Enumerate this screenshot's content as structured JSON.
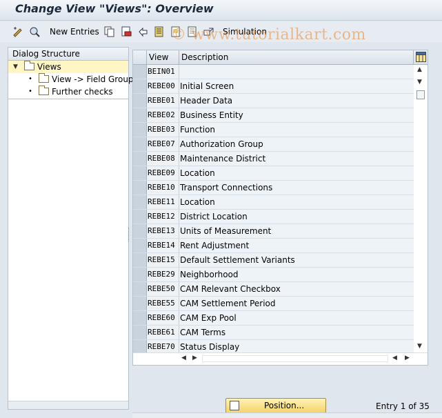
{
  "window": {
    "title": "Change View \"Views\": Overview"
  },
  "toolbar": {
    "new_entries_label": "New Entries",
    "simulation_label": "Simulation",
    "icons": [
      "display-change-icon",
      "display-icon",
      "copy-icon",
      "delete-icon",
      "undo-icon",
      "select-all-icon",
      "select-block-icon",
      "deselect-icon",
      "transport-icon"
    ]
  },
  "watermark": "© www.tutorialkart.com",
  "dialog_structure": {
    "header": "Dialog Structure",
    "items": [
      {
        "label": "Views",
        "selected": true
      },
      {
        "label": "View -> Field Groups"
      },
      {
        "label": "Further checks"
      }
    ]
  },
  "table": {
    "columns": [
      "View",
      "Description"
    ],
    "rows": [
      {
        "view": "BEIN01",
        "description": ""
      },
      {
        "view": "REBE00",
        "description": "Initial Screen"
      },
      {
        "view": "REBE01",
        "description": "Header Data"
      },
      {
        "view": "REBE02",
        "description": "Business Entity"
      },
      {
        "view": "REBE03",
        "description": "Function"
      },
      {
        "view": "REBE07",
        "description": "Authorization Group"
      },
      {
        "view": "REBE08",
        "description": "Maintenance District"
      },
      {
        "view": "REBE09",
        "description": "Location"
      },
      {
        "view": "REBE10",
        "description": "Transport Connections"
      },
      {
        "view": "REBE11",
        "description": "Location"
      },
      {
        "view": "REBE12",
        "description": "District Location"
      },
      {
        "view": "REBE13",
        "description": "Units of Measurement"
      },
      {
        "view": "REBE14",
        "description": "Rent Adjustment"
      },
      {
        "view": "REBE15",
        "description": "Default Settlement Variants"
      },
      {
        "view": "REBE29",
        "description": "Neighborhood"
      },
      {
        "view": "REBE50",
        "description": "CAM Relevant Checkbox"
      },
      {
        "view": "REBE55",
        "description": "CAM Settlement Period"
      },
      {
        "view": "REBE60",
        "description": "CAM Exp Pool"
      },
      {
        "view": "REBE61",
        "description": "CAM Terms"
      },
      {
        "view": "REBE70",
        "description": "Status Display"
      }
    ]
  },
  "footer": {
    "position_label": "Position...",
    "entry_label": "Entry 1 of 35"
  },
  "colors": {
    "accent": "#f4d36a",
    "selected_tree": "#fff6c4"
  }
}
